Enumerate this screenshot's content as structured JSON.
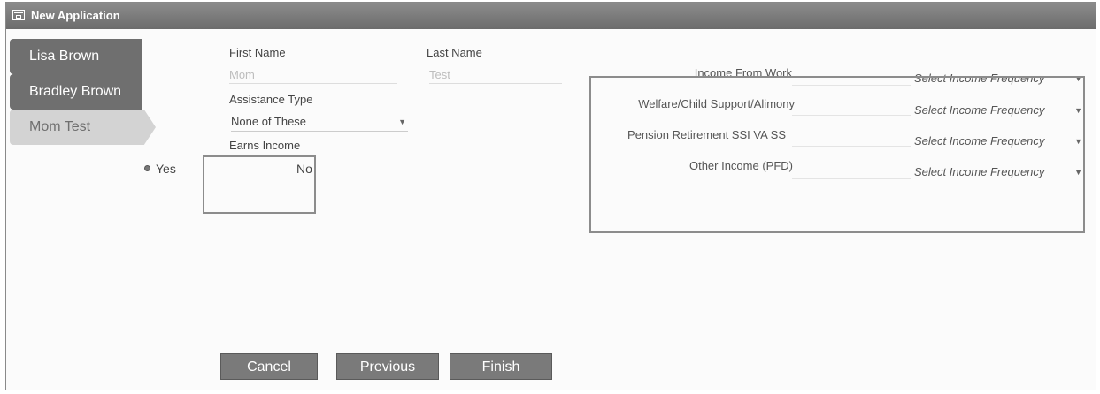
{
  "window": {
    "title": "New Application"
  },
  "applicants": [
    {
      "name": "Lisa Brown",
      "active": false
    },
    {
      "name": "Bradley Brown",
      "active": false
    },
    {
      "name": "Mom Test",
      "active": true
    }
  ],
  "form": {
    "first_name_label": "First Name",
    "first_name_value": "Mom",
    "last_name_label": "Last Name",
    "last_name_value": "Test",
    "assistance_type_label": "Assistance Type",
    "assistance_type_value": "None of These",
    "earns_income_label": "Earns Income",
    "earns_income_yes": "Yes",
    "earns_income_no": "No",
    "earns_income_selected": "Yes"
  },
  "income": {
    "rows": [
      {
        "label": "Income From Work",
        "frequency_placeholder": "Select Income Frequency"
      },
      {
        "label": "Welfare/Child Support/Alimony",
        "frequency_placeholder": "Select Income Frequency"
      },
      {
        "label": "Pension Retirement SSI VA SS",
        "frequency_placeholder": "Select Income Frequency"
      },
      {
        "label": "Other Income (PFD)",
        "frequency_placeholder": "Select Income Frequency"
      }
    ]
  },
  "buttons": {
    "cancel": "Cancel",
    "previous": "Previous",
    "finish": "Finish"
  }
}
